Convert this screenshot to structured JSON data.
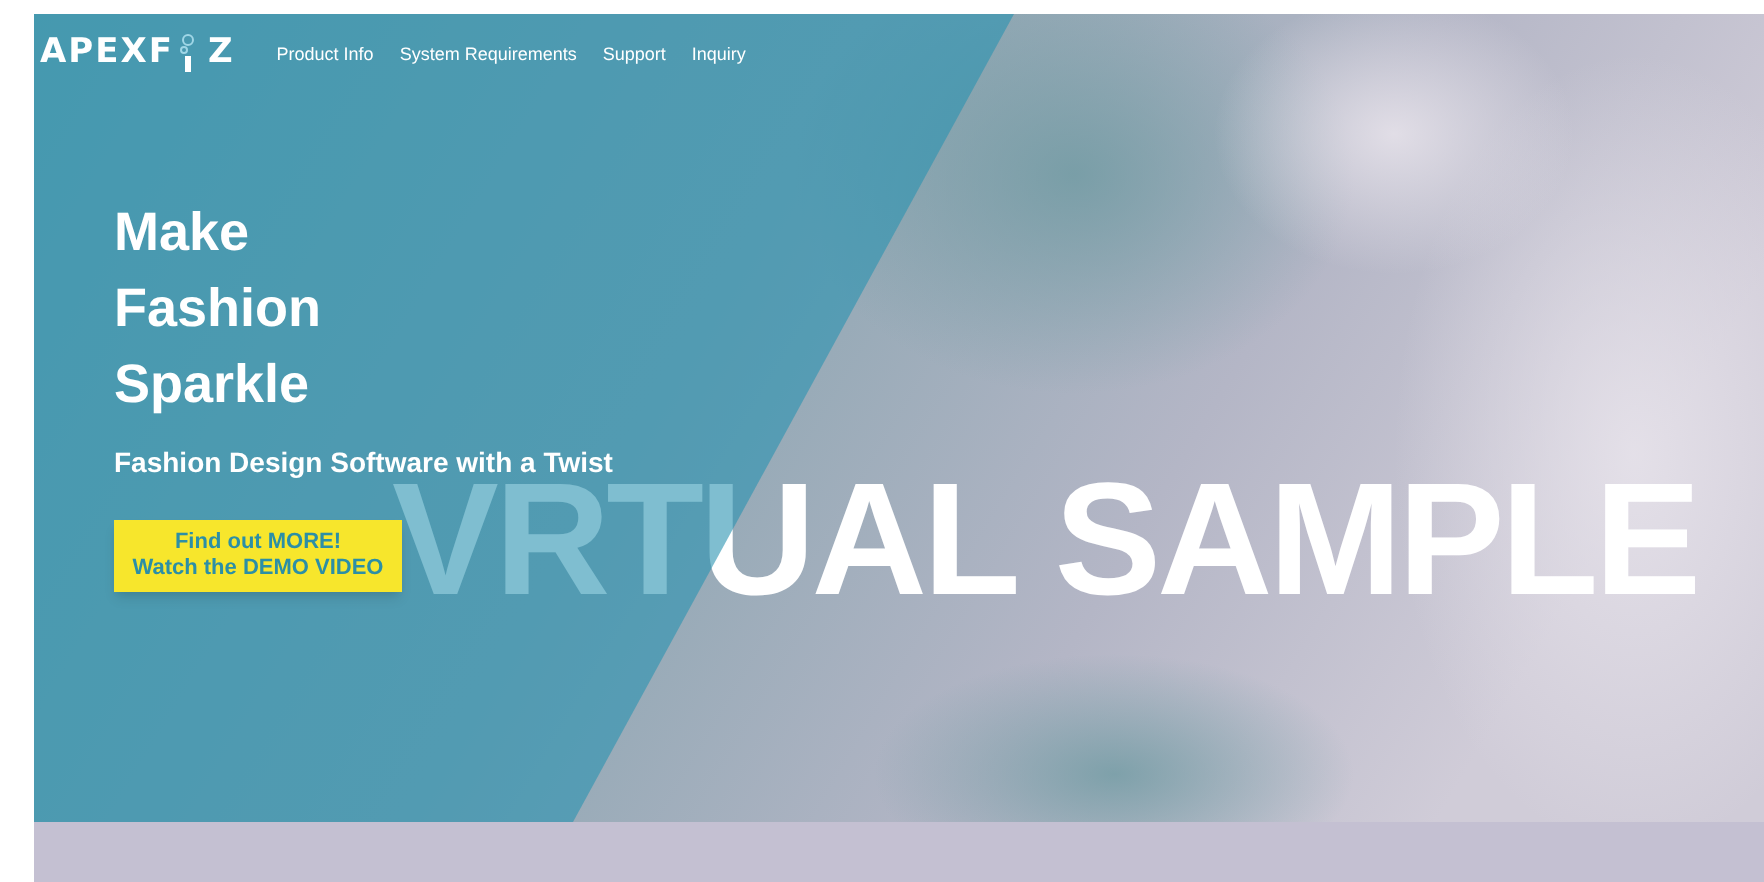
{
  "logo": {
    "text": "APEXF",
    "text_end": "Z"
  },
  "nav": [
    {
      "label": "Product Info"
    },
    {
      "label": "System Requirements"
    },
    {
      "label": "Support"
    },
    {
      "label": "Inquiry"
    }
  ],
  "hero": {
    "title_lines": [
      "Make",
      "Fashion",
      "Sparkle"
    ],
    "subtitle": "Fashion Design Software with a Twist",
    "button_lines": [
      "Find out MORE!",
      "Watch the DEMO VIDEO"
    ],
    "backdrop_text": "VRTUAL SAMPLE"
  }
}
